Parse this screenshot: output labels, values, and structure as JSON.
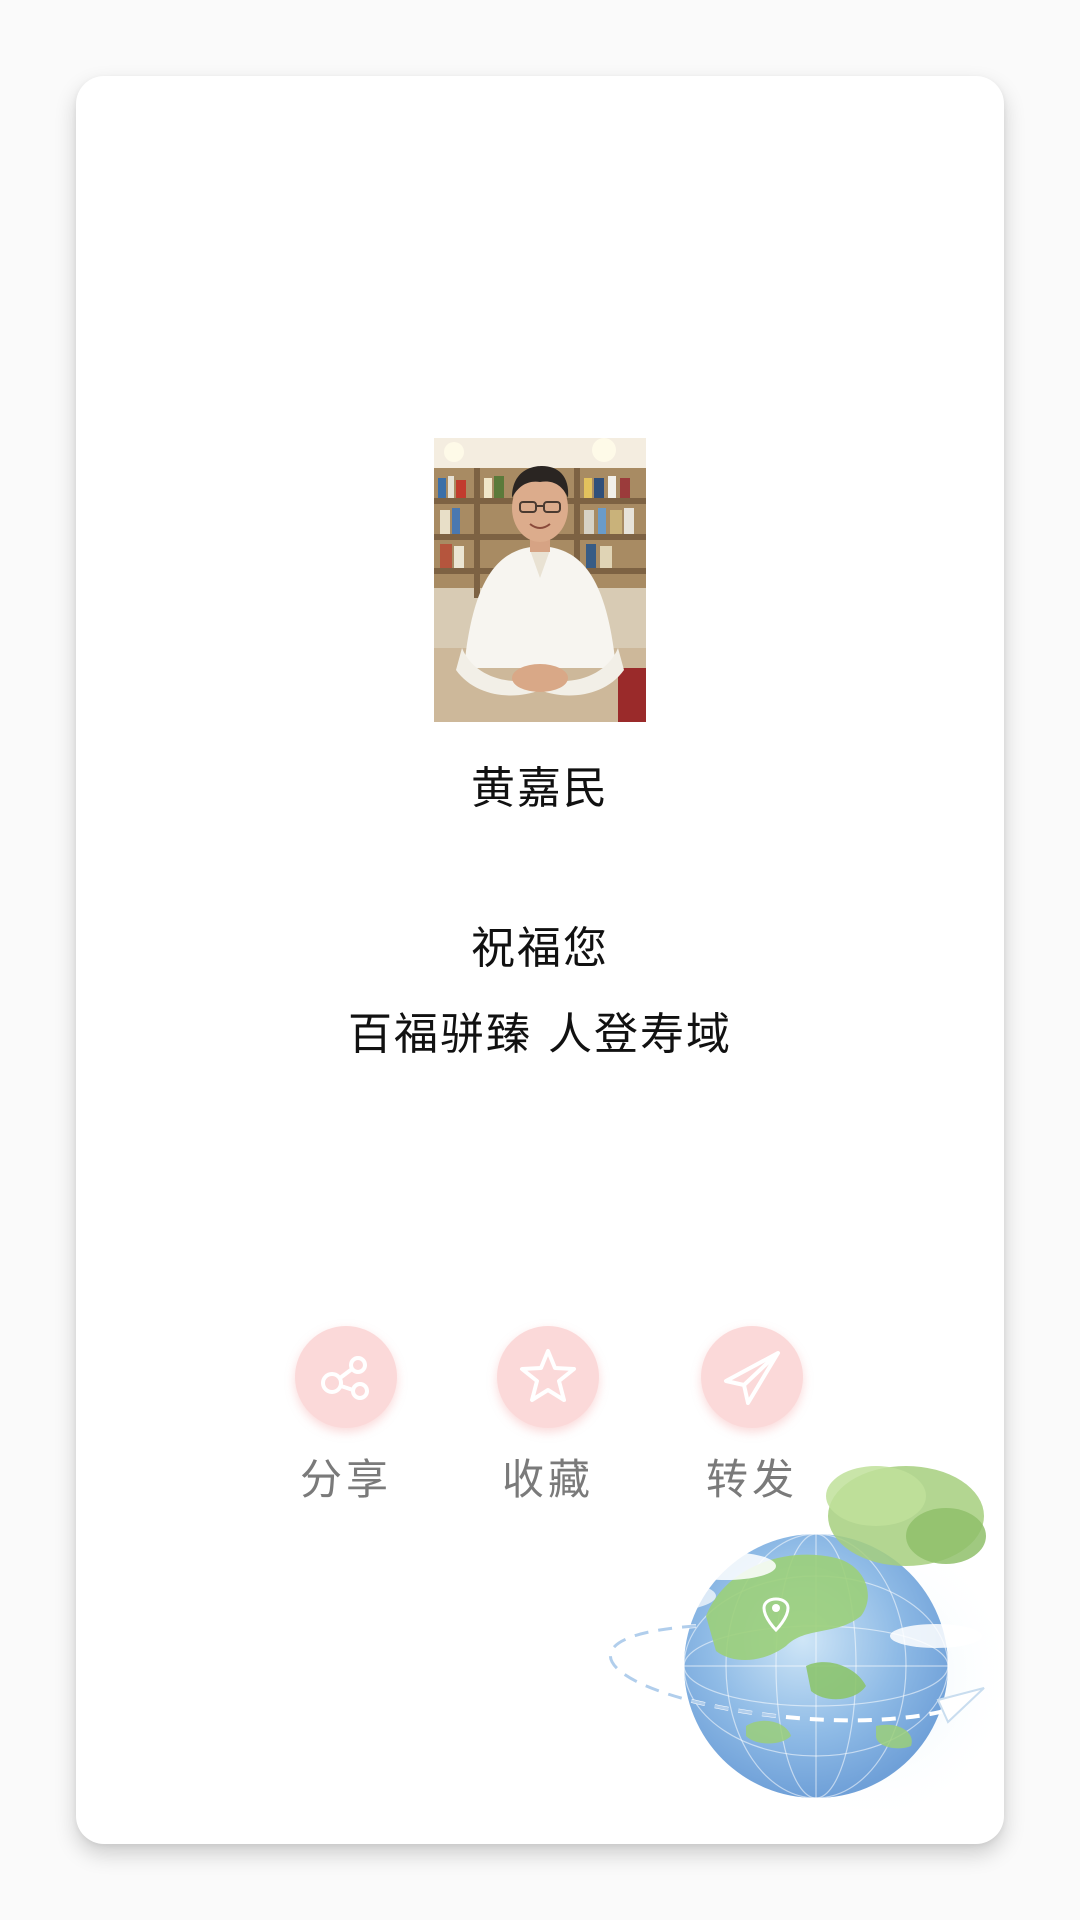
{
  "profile": {
    "name": "黄嘉民"
  },
  "blessing": {
    "title": "祝福您",
    "text": "百福骈臻 人登寿域"
  },
  "actions": [
    {
      "label": "分享",
      "icon": "share-icon"
    },
    {
      "label": "收藏",
      "icon": "star-icon"
    },
    {
      "label": "转发",
      "icon": "paper-plane-icon"
    }
  ],
  "colors": {
    "action_circle": "#fbd9d9",
    "label_text": "#7a7a7a"
  }
}
